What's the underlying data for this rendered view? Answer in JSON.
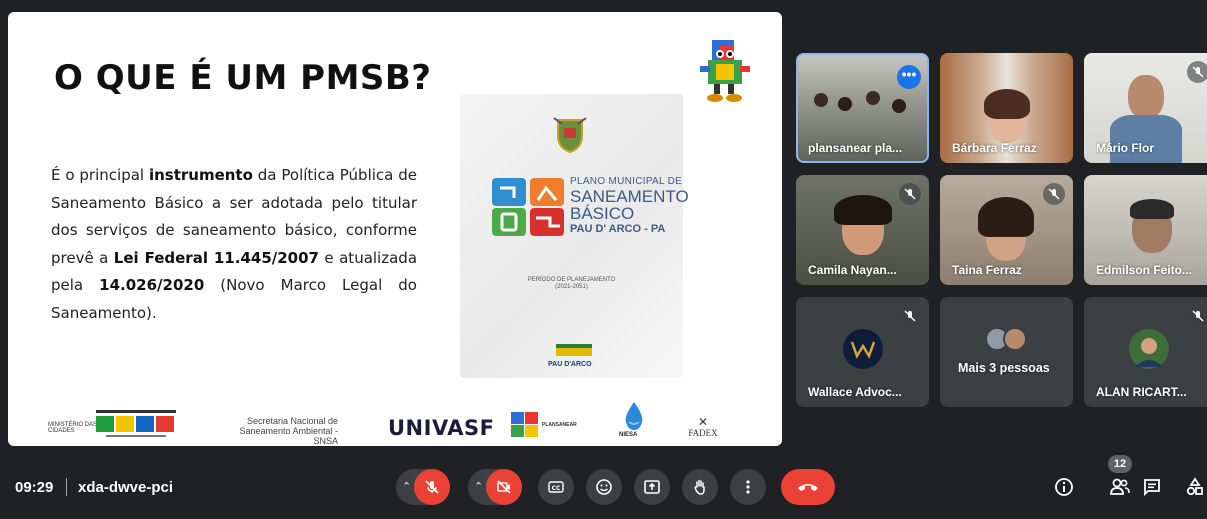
{
  "slide": {
    "title": "O QUE É UM PMSB?",
    "body_1": "É o principal ",
    "body_bold_1": "instrumento",
    "body_2": " da Política Pública de Saneamento Básico a ser adotada pelo titular dos serviços de saneamento básico, conforme prevê a ",
    "body_bold_2": "Lei Federal 11.445/2007",
    "body_3": " e atualizada pela ",
    "body_bold_3": "14.026/2020",
    "body_4": " (Novo Marco Legal do Saneamento).",
    "cover": {
      "title_l1": "PLANO MUNICIPAL DE",
      "title_l2": "SANEAMENTO",
      "title_l3": "BÁSICO",
      "title_l4": "PAU D' ARCO - PA",
      "period": "PERÍODO DE PLANEJAMENTO",
      "period_years": "(2021-2051)",
      "city_logo": "PAU D'ARCO"
    },
    "footer": {
      "ministerio": "MINISTÉRIO DAS CIDADES",
      "snsa_l1": "Secretaria Nacional de",
      "snsa_l2": "Saneamento Ambiental - SNSA",
      "univasf": "UNIVASF",
      "plansanear": "PLANSANEAR",
      "niesa": "NIESA",
      "fadex": "FADEX"
    }
  },
  "participants": [
    {
      "name": "plansanear pla..."
    },
    {
      "name": "Bárbara Ferraz"
    },
    {
      "name": "Mário Flor"
    },
    {
      "name": "Camila Nayan..."
    },
    {
      "name": "Taina Ferraz"
    },
    {
      "name": "Edmilson Feito..."
    },
    {
      "name": "Wallace Advoc..."
    },
    {
      "name": "Mais 3 pessoas"
    },
    {
      "name": "ALAN RICART..."
    }
  ],
  "bar": {
    "time": "09:29",
    "meeting_code": "xda-dwve-pci",
    "people_count": "12"
  },
  "colors": {
    "background": "#202124",
    "control": "#3c4043",
    "danger": "#ea4335",
    "accent": "#1a73e8"
  }
}
